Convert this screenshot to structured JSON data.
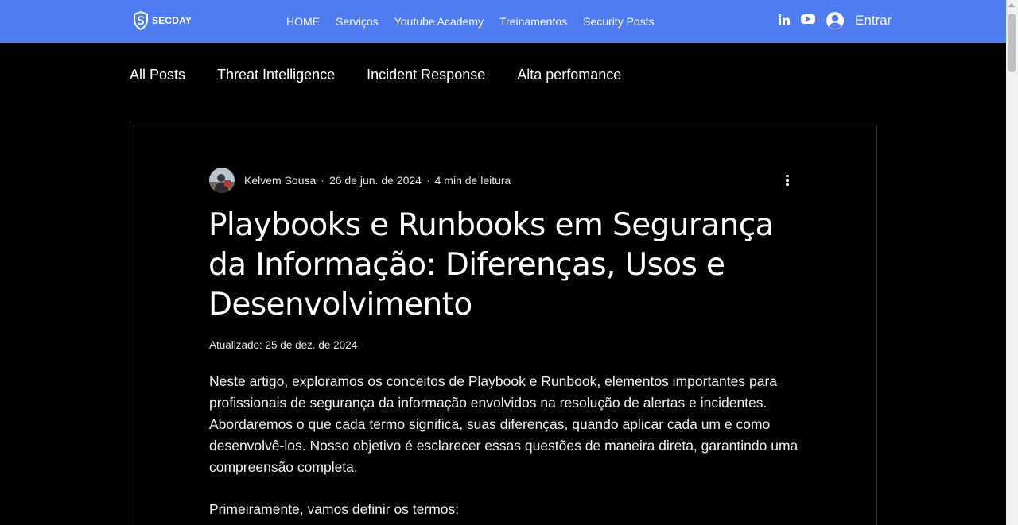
{
  "header": {
    "logo_text": "SECDAY",
    "nav": [
      "HOME",
      "Serviços",
      "Youtube Academy",
      "Treinamentos",
      "Security Posts"
    ],
    "login_label": "Entrar",
    "social": [
      "linkedin-icon",
      "youtube-icon"
    ]
  },
  "categories": [
    "All Posts",
    "Threat Intelligence",
    "Incident Response",
    "Alta perfomance"
  ],
  "post": {
    "author": "Kelvem Sousa",
    "date": "26 de jun. de 2024",
    "read_time": "4 min de leitura",
    "separator": "·",
    "title": "Playbooks e Runbooks em Segurança da Informação: Diferenças, Usos e Desenvolvimento",
    "updated": "Atualizado: 25 de dez. de 2024",
    "intro": "Neste artigo, exploramos os conceitos de Playbook e Runbook, elementos importantes para profissionais de segurança da informação envolvidos na resolução de alertas e incidentes. Abordaremos o que cada termo significa, suas diferenças, quando aplicar cada um e como desenvolvê-los. Nosso objetivo é esclarecer essas questões de maneira direta, garantindo uma compreensão completa.",
    "para2": "Primeiramente, vamos definir os termos:"
  },
  "colors": {
    "header_bg": "#4f7cf0",
    "page_bg": "#000000"
  }
}
